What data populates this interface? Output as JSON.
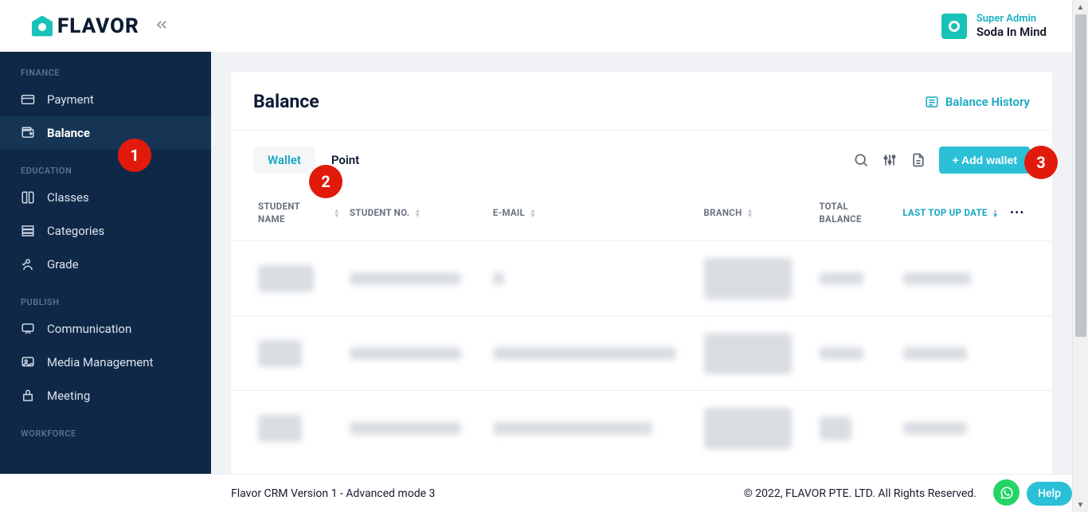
{
  "brand": "FLAVOR",
  "user": {
    "role": "Super Admin",
    "name": "Soda In Mind"
  },
  "sidebar": {
    "sections": [
      {
        "label": "FINANCE",
        "items": [
          {
            "icon": "card",
            "label": "Payment",
            "active": false
          },
          {
            "icon": "wallet",
            "label": "Balance",
            "active": true
          }
        ]
      },
      {
        "label": "EDUCATION",
        "items": [
          {
            "icon": "book",
            "label": "Classes",
            "active": false
          },
          {
            "icon": "stack",
            "label": "Categories",
            "active": false
          },
          {
            "icon": "grade",
            "label": "Grade",
            "active": false
          }
        ]
      },
      {
        "label": "PUBLISH",
        "items": [
          {
            "icon": "chat",
            "label": "Communication",
            "active": false
          },
          {
            "icon": "media",
            "label": "Media Management",
            "active": false
          },
          {
            "icon": "meet",
            "label": "Meeting",
            "active": false
          }
        ]
      },
      {
        "label": "WORKFORCE",
        "items": []
      }
    ]
  },
  "page": {
    "title": "Balance",
    "history_link": "Balance History",
    "tabs": {
      "wallet": "Wallet",
      "point": "Point"
    },
    "add_button": "+ Add wallet",
    "columns": {
      "student_name": "STUDENT NAME",
      "student_no": "STUDENT NO.",
      "email": "E-MAIL",
      "branch": "BRANCH",
      "total_balance": "TOTAL BALANCE",
      "last_topup": "LAST TOP UP DATE"
    }
  },
  "footer": {
    "version": "Flavor CRM Version 1 - Advanced mode 3",
    "copyright": "© 2022, FLAVOR PTE. LTD. All Rights Reserved."
  },
  "help": "Help",
  "callouts": {
    "c1": "1",
    "c2": "2",
    "c3": "3"
  }
}
